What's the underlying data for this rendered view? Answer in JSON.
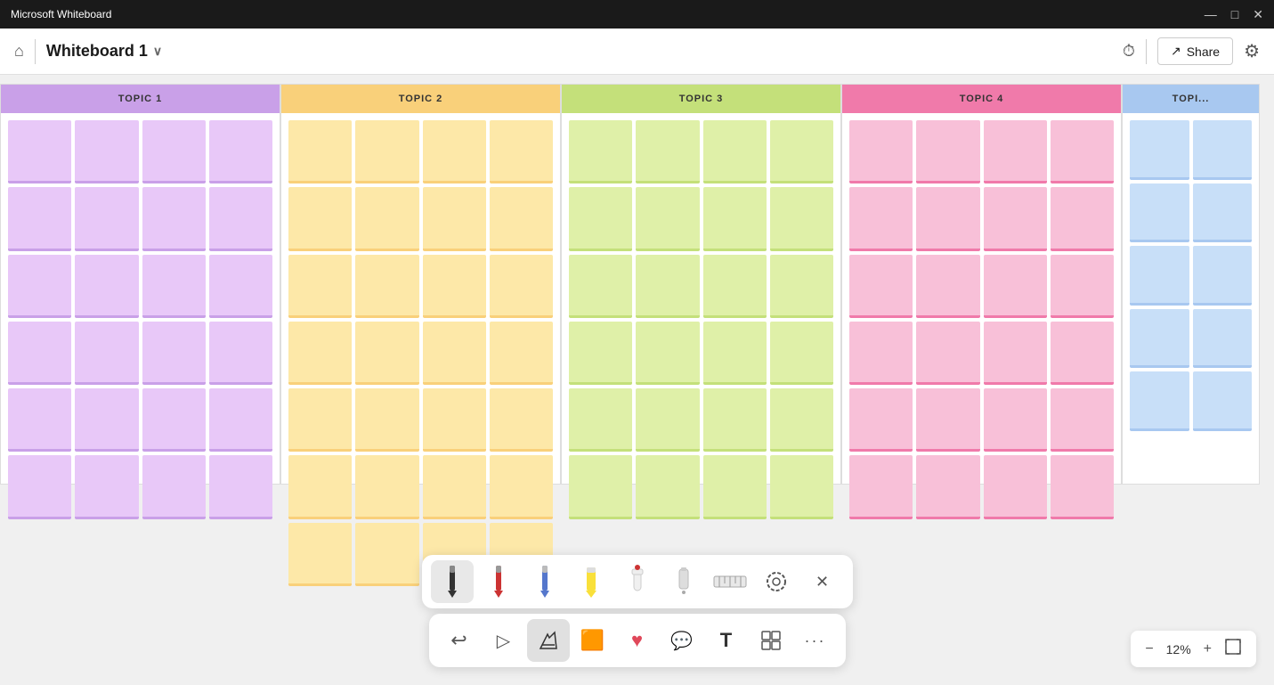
{
  "title_bar": {
    "app_name": "Microsoft Whiteboard",
    "minimize": "—",
    "maximize": "□",
    "close": "✕"
  },
  "app_bar": {
    "home_icon": "⌂",
    "board_title": "Whiteboard 1",
    "chevron": "∨",
    "timer_icon": "⏱",
    "share_label": "Share",
    "share_icon": "↗",
    "settings_icon": "⚙"
  },
  "topics": [
    {
      "label": "TOPIC 1",
      "color_class": "col-purple",
      "rows": 6,
      "cols": 4
    },
    {
      "label": "TOPIC 2",
      "color_class": "col-orange",
      "rows": 7,
      "cols": 4
    },
    {
      "label": "TOPIC 3",
      "color_class": "col-green",
      "rows": 6,
      "cols": 4
    },
    {
      "label": "TOPIC 4",
      "color_class": "col-pink",
      "rows": 6,
      "cols": 4
    },
    {
      "label": "TOPIC",
      "color_class": "col-blue",
      "rows": 5,
      "cols": 2,
      "partial": true
    }
  ],
  "toolbar_top": {
    "tools": [
      {
        "name": "pen-tool",
        "icon": "✒️",
        "active": true
      },
      {
        "name": "red-pen-tool",
        "icon": "🖊️"
      },
      {
        "name": "blue-pen-tool",
        "icon": "✏️"
      },
      {
        "name": "highlighter-tool",
        "icon": "🖍️"
      },
      {
        "name": "glue-tool",
        "icon": "🧴"
      },
      {
        "name": "eraser-tool",
        "icon": "🧹"
      },
      {
        "name": "ruler-tool",
        "icon": "📏"
      },
      {
        "name": "lasso-tool",
        "icon": "⊙"
      },
      {
        "name": "close-toolbar",
        "icon": "✕"
      }
    ]
  },
  "toolbar_bottom": {
    "tools": [
      {
        "name": "undo-button",
        "icon": "↩",
        "label": "Undo"
      },
      {
        "name": "select-tool",
        "icon": "▷",
        "label": "Select"
      },
      {
        "name": "ink-tool",
        "icon": "✏",
        "label": "Ink",
        "active": true
      },
      {
        "name": "shape-tool",
        "icon": "⬟",
        "label": "Shape"
      },
      {
        "name": "heart-tool",
        "icon": "♥",
        "label": "Reaction"
      },
      {
        "name": "comment-tool",
        "icon": "💬",
        "label": "Comment"
      },
      {
        "name": "text-tool",
        "icon": "T",
        "label": "Text"
      },
      {
        "name": "template-tool",
        "icon": "⧉",
        "label": "Template"
      },
      {
        "name": "more-tool",
        "icon": "···",
        "label": "More"
      }
    ]
  },
  "zoom": {
    "zoom_out_label": "−",
    "zoom_level": "12%",
    "zoom_in_label": "+",
    "fit_label": "⊞"
  }
}
